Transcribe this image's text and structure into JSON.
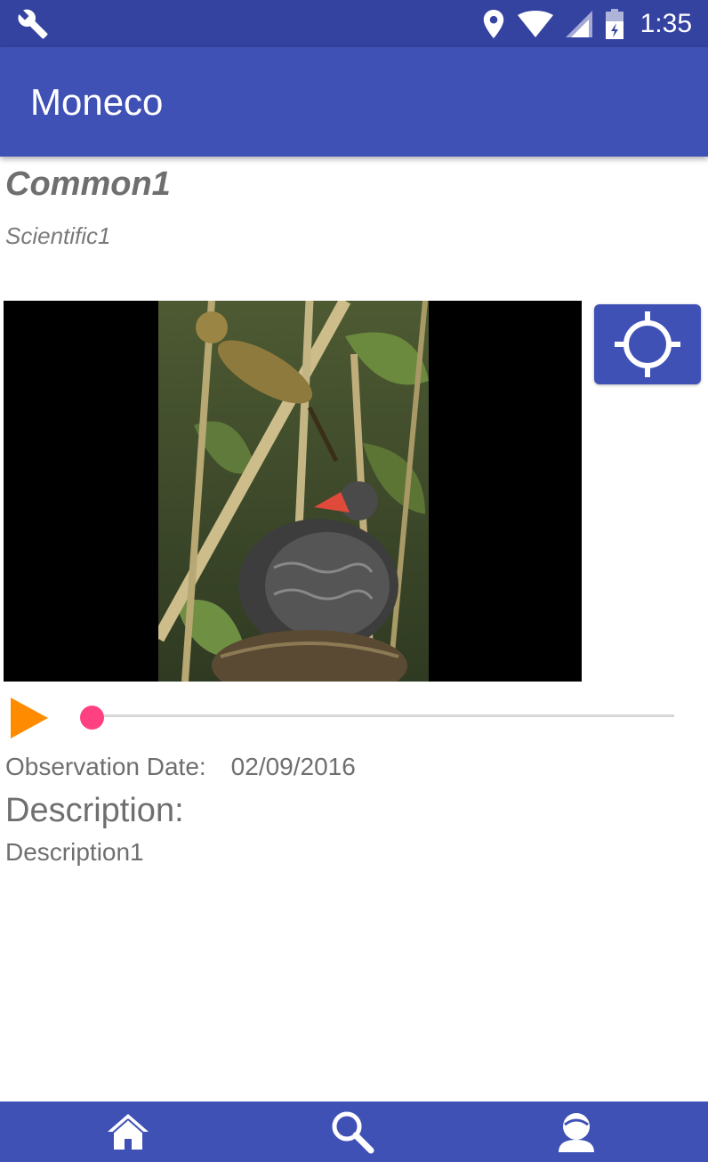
{
  "status_bar": {
    "time": "1:35",
    "icons": [
      "wrench-icon",
      "location-icon",
      "wifi-icon",
      "signal-icon",
      "battery-icon"
    ]
  },
  "app_bar": {
    "title": "Moneco"
  },
  "species": {
    "common_name": "Common1",
    "scientific_name": "Scientific1"
  },
  "media": {
    "image_subject": "cuckoo-chick-fed-by-reed-warbler",
    "playback_progress": 0.0
  },
  "observation": {
    "date_label": "Observation Date:",
    "date_value": "02/09/2016"
  },
  "description": {
    "heading": "Description:",
    "text": "Description1"
  },
  "bottom_nav": {
    "items": [
      "home-icon",
      "search-icon",
      "profile-icon"
    ]
  },
  "colors": {
    "primary": "#3f51b5",
    "primary_dark": "#3442a0",
    "play_accent": "#ff8c00",
    "seek_accent": "#ff4081"
  }
}
